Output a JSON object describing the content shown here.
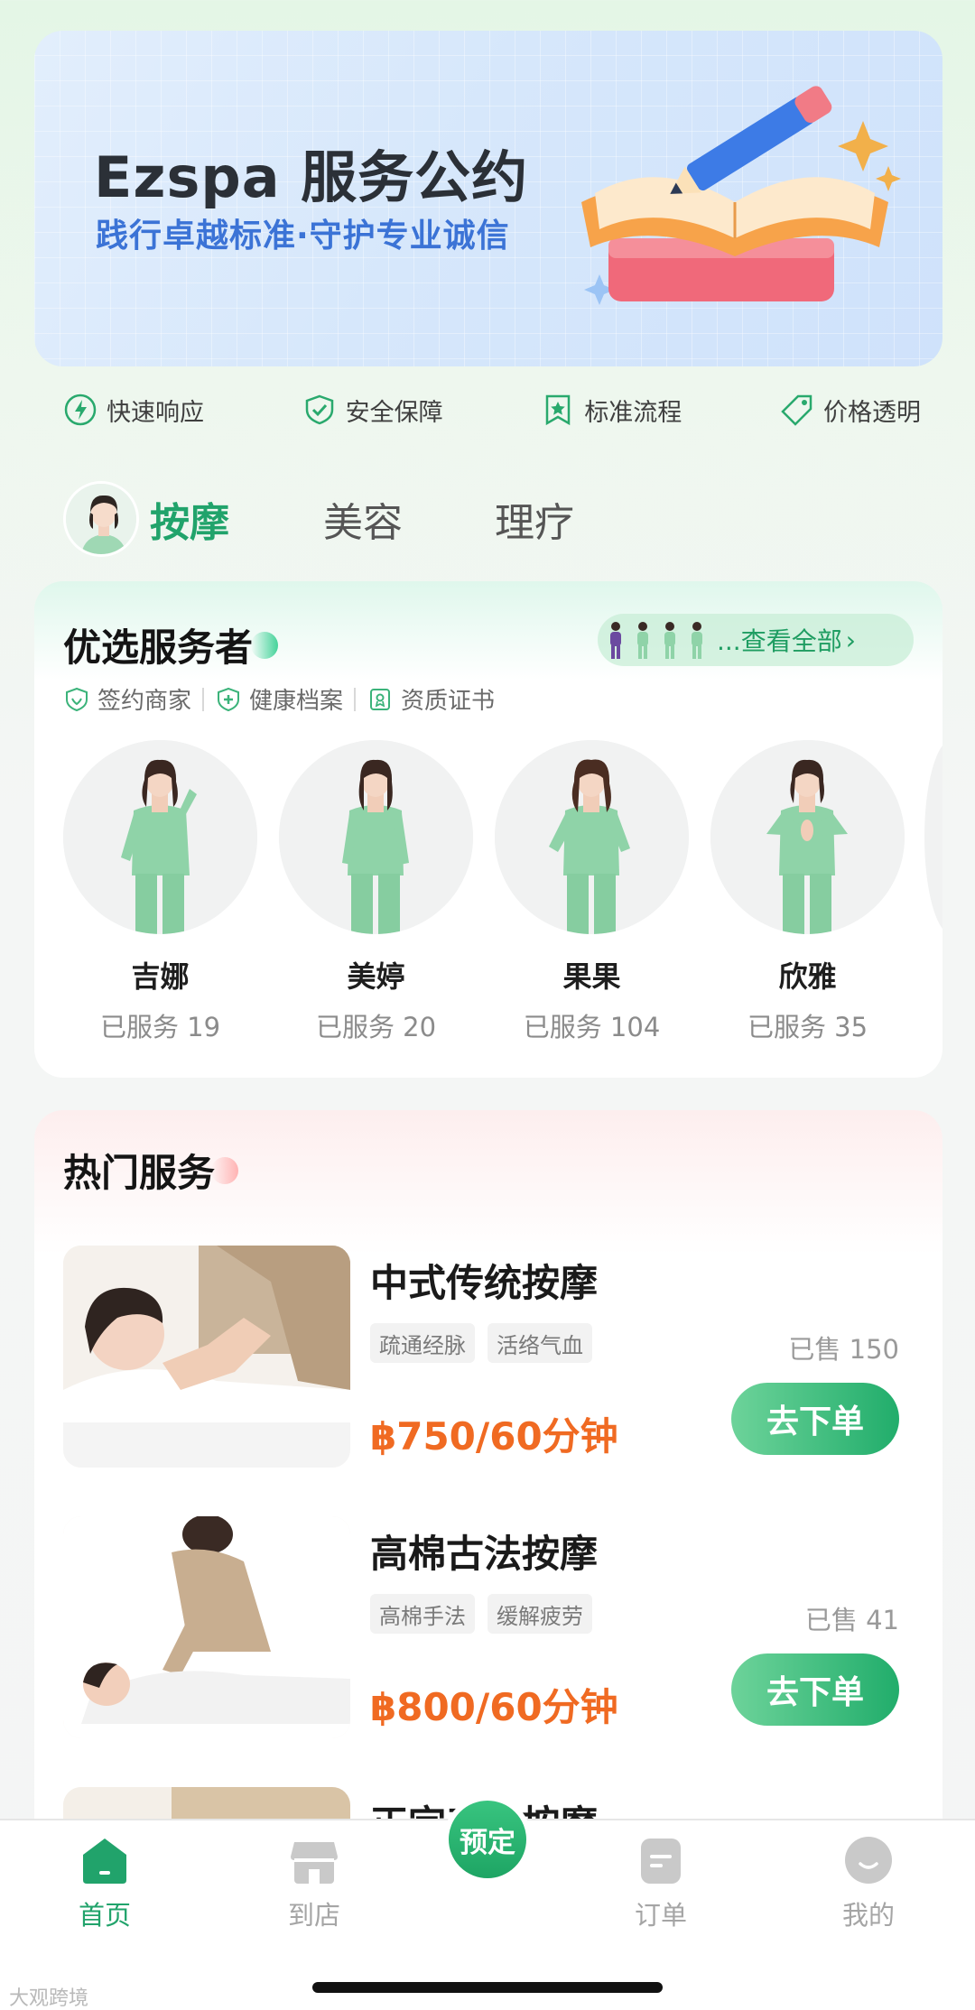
{
  "banner": {
    "title": "Ezspa 服务公约",
    "subtitle": "践行卓越标准·守护专业诚信"
  },
  "features": [
    {
      "label": "快速响应",
      "icon": "lightning-icon"
    },
    {
      "label": "安全保障",
      "icon": "shield-check-icon"
    },
    {
      "label": "标准流程",
      "icon": "bookmark-star-icon"
    },
    {
      "label": "价格透明",
      "icon": "price-tag-icon"
    }
  ],
  "tabs": [
    {
      "label": "按摩",
      "active": true
    },
    {
      "label": "美容",
      "active": false
    },
    {
      "label": "理疗",
      "active": false
    }
  ],
  "staff_section": {
    "title": "优选服务者",
    "see_all": "...查看全部",
    "badges": [
      "签约商家",
      "健康档案",
      "资质证书"
    ],
    "staff": [
      {
        "name": "吉娜",
        "served": "已服务 19"
      },
      {
        "name": "美婷",
        "served": "已服务 20"
      },
      {
        "name": "果果",
        "served": "已服务 104"
      },
      {
        "name": "欣雅",
        "served": "已服务 35"
      }
    ]
  },
  "hot_section": {
    "title": "热门服务",
    "services": [
      {
        "name": "中式传统按摩",
        "tags": [
          "疏通经脉",
          "活络气血"
        ],
        "sold": "已售 150",
        "price": "฿750/60分钟",
        "button": "去下单"
      },
      {
        "name": "高棉古法按摩",
        "tags": [
          "高棉手法",
          "缓解疲劳"
        ],
        "sold": "已售 41",
        "price": "฿800/60分钟",
        "button": "去下单"
      },
      {
        "name": "正宗泰式按摩"
      }
    ]
  },
  "bottom_nav": {
    "items": [
      {
        "label": "首页",
        "active": true
      },
      {
        "label": "到店",
        "active": false
      },
      {
        "label": "订单",
        "active": false
      },
      {
        "label": "我的",
        "active": false
      }
    ],
    "book": "预定"
  },
  "watermark": "大观跨境",
  "colors": {
    "brand_green": "#21a36b",
    "price_orange": "#f06a22",
    "banner_blue": "#3b73d6"
  }
}
